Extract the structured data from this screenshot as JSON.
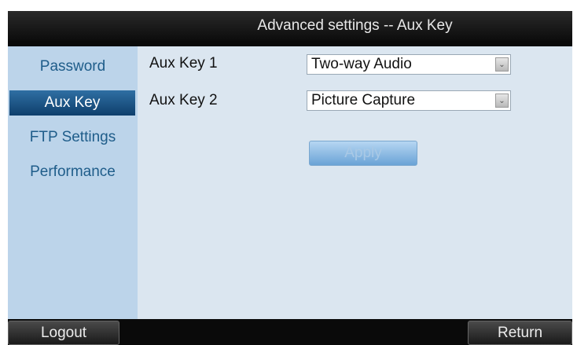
{
  "header": {
    "title": "Advanced settings -- Aux Key"
  },
  "sidebar": {
    "items": [
      {
        "label": "Password"
      },
      {
        "label": "Aux Key"
      },
      {
        "label": "FTP Settings"
      },
      {
        "label": "Performance"
      }
    ],
    "active": "Aux Key"
  },
  "form": {
    "aux_key_1": {
      "label": "Aux Key 1",
      "value": "Two-way Audio"
    },
    "aux_key_2": {
      "label": "Aux Key 2",
      "value": "Picture Capture"
    },
    "apply_label": "Apply"
  },
  "footer": {
    "logout_label": "Logout",
    "return_label": "Return"
  },
  "icons": {
    "dropdown": "chevron-down-icon"
  },
  "colors": {
    "active_item": "#1f5a8f",
    "sidebar_bg": "#bcd4ea",
    "content_bg": "#dbe6f0",
    "sidebar_text": "#1f5d8a"
  }
}
